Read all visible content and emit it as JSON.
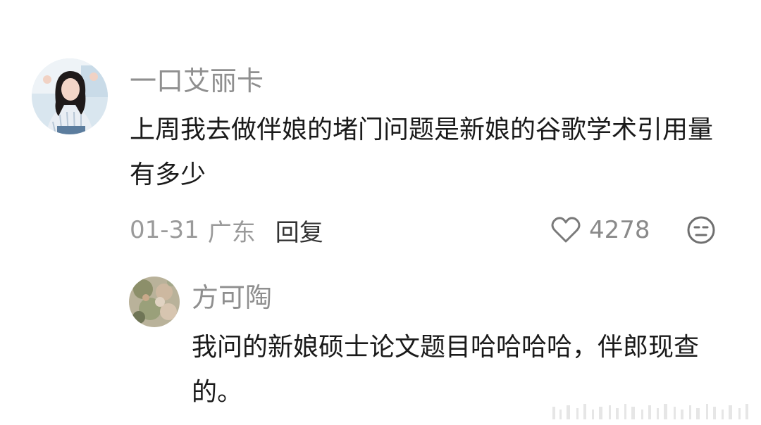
{
  "comment": {
    "username": "一口艾丽卡",
    "text": "上周我去做伴娘的堵门问题是新娘的谷歌学术引用量有多少",
    "date": "01-31",
    "region": "广东",
    "reply_label": "回复",
    "like_count": "4278",
    "icons": {
      "like": "heart-outline-icon",
      "react": "emoji-face-icon"
    }
  },
  "reply": {
    "username": "方可陶",
    "text": "我问的新娘硕士论文题目哈哈哈哈，伴郎现查的。"
  },
  "colors": {
    "username": "#8f8f8f",
    "text": "#1a1a1a",
    "meta": "#9a9a9a",
    "reply_button": "#333333"
  }
}
